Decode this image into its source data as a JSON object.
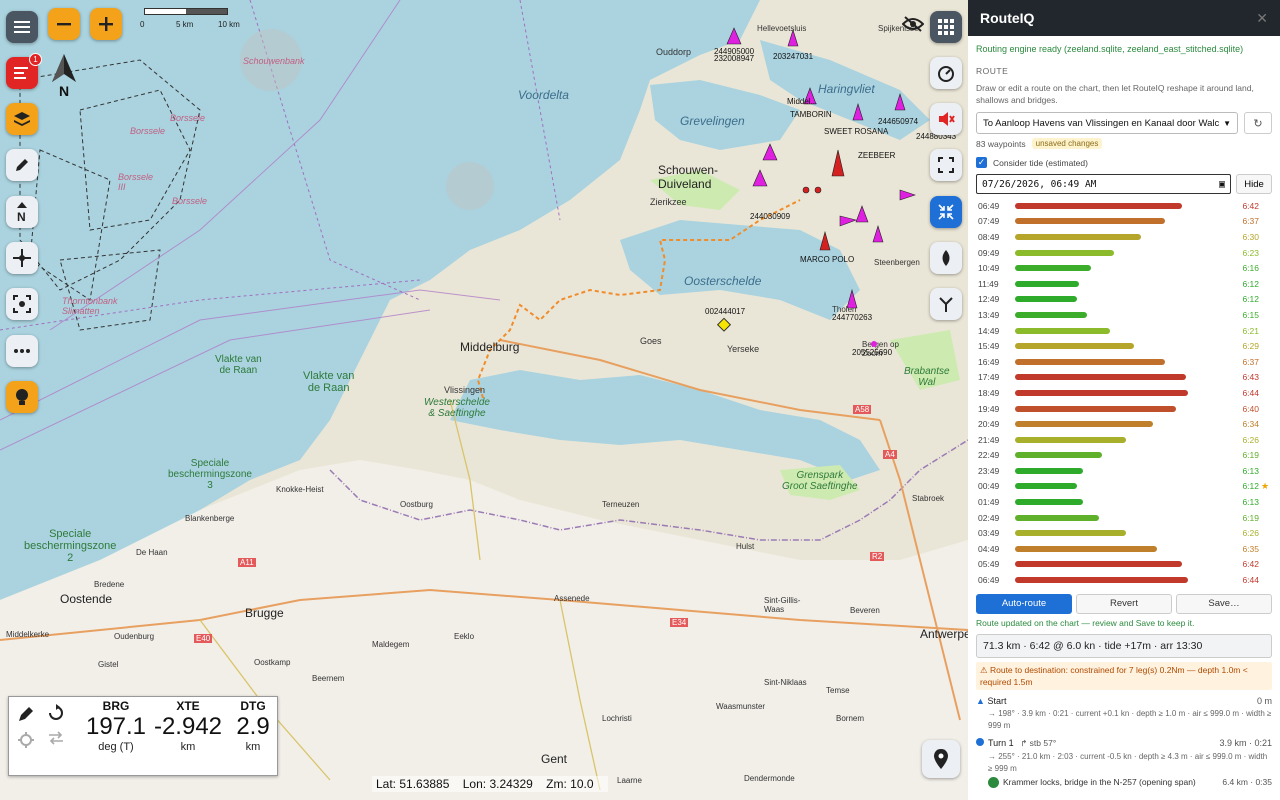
{
  "map": {
    "scale": {
      "t0": "0",
      "t1": "5 km",
      "t2": "10 km"
    },
    "labels": {
      "schouwenbank": "Schouwenbank",
      "voordelta": "Voordelta",
      "grevelingen": "Grevelingen",
      "haringvliet": "Haringvliet",
      "schouwen": "Schouwen-\nDuiveland",
      "oosterschelde": "Oosterschelde",
      "zierikzee": "Zierikzee",
      "middelburg": "Middelburg",
      "vlissingen": "Vlissingen",
      "goes": "Goes",
      "yerseke": "Yerseke",
      "tholen": "Tholen",
      "steenbergen": "Steenbergen",
      "oudorp": "Ouddorp",
      "hellevoetsluis": "Hellevoetsluis",
      "spijkenisse": "Spijkenisse",
      "borssele1": "Borssele",
      "borssele2": "Borssele",
      "borssele3": "Borssele",
      "borssele4": "Borssele\nIII",
      "thornton": "Thorntonbank\nSlimatten",
      "vlakte1": "Vlakte van\nde Raan",
      "vlakte2": "Vlakte van\nde Raan",
      "westerschelde": "Westerschelde\n& Saeftinghe",
      "speciale3": "Speciale\nbeschermingszone\n3",
      "speciale2": "Speciale\nbeschermingszone\n2",
      "knokke": "Knokke-Heist",
      "blankenberge": "Blankenberge",
      "dehaan": "De Haan",
      "bredene": "Bredene",
      "oostende": "Oostende",
      "brugge": "Brugge",
      "middelkerke": "Middelkerke",
      "oudenburg": "Oudenburg",
      "gistel": "Gistel",
      "oostkamp": "Oostkamp",
      "beernem": "Beernem",
      "maldegem": "Maldegem",
      "eeklo": "Eeklo",
      "assenede": "Assenede",
      "terneuzen": "Terneuzen",
      "oostburg": "Oostburg",
      "hulst": "Hulst",
      "sintgillis": "Sint-Gillis-\nWaas",
      "beveren": "Beveren",
      "antwerpen": "Antwerpen",
      "stabroek": "Stabroek",
      "grenspark": "Grenspark\nGroot Saeftinghe",
      "brabantse": "Brabantse\nWal",
      "bergen": "Bergen op\nZoom",
      "stniklaas": "Sint-Niklaas",
      "lochristi": "Lochristi",
      "waasmunster": "Waasmunster",
      "temse": "Temse",
      "bornem": "Bornem",
      "gent": "Gent",
      "laarne": "Laarne",
      "dendermonde": "Dendermonde",
      "a58": "A58",
      "a4": "A4",
      "r2": "R2",
      "e40": "E40",
      "e34": "E34",
      "a11": "A11",
      "v1": "244905000\n232008947",
      "v2": "203247031",
      "v3": "244650974",
      "v4": "244880343",
      "v5": "002444017",
      "v6": "244770263",
      "v7": "205525690",
      "v8": "244030909",
      "v9": "MARCO POLO",
      "v10": "ZEEBEER",
      "v11": "TAMBORIN",
      "v12": "Middel...",
      "v13": "SWEET ROSANA"
    }
  },
  "coords": {
    "lat": "Lat: 51.63885",
    "lon": "Lon: 3.24329",
    "zoom": "Zm: 10.0"
  },
  "nav": {
    "brg": {
      "label": "BRG",
      "value": "197.1",
      "unit": "deg (T)"
    },
    "xte": {
      "label": "XTE",
      "value": "-2.942",
      "unit": "km"
    },
    "dtg": {
      "label": "DTG",
      "value": "2.9",
      "unit": "km"
    }
  },
  "notify_badge": "1",
  "panel": {
    "title": "RouteIQ",
    "close": "✕",
    "status": "Routing engine ready (zeeland.sqlite, zeeland_east_stitched.sqlite)",
    "section": "ROUTE",
    "help": "Draw or edit a route on the chart, then let RouteIQ reshape it around land, shallows and bridges.",
    "route_select": "To Aanloop Havens van Vlissingen en Kanaal door Walcheren",
    "waypoints": "83 waypoints",
    "unsaved": "unsaved changes",
    "consider_tide": "Consider tide (estimated)",
    "datetime": "07/26/2026, 06:49 AM",
    "hide": "Hide",
    "buttons": {
      "auto": "Auto-route",
      "revert": "Revert",
      "save": "Save…"
    },
    "updated": "Route updated on the chart — review and Save to keep it.",
    "summary": "71.3 km · 6:42 @ 6.0 kn · tide +17m · arr 13:30",
    "warning": "⚠ Route to destination: constrained for 7 leg(s) 0.2Nm — depth 1.0m < required 1.5m",
    "legs": [
      {
        "name": "Start",
        "right": "0 m",
        "detail": "→ 198° · 3.9 km · 0:21 · current +0.1 kn · depth ≥ 1.0 m · air ≤ 999.0 m · width ≥ 999 m"
      },
      {
        "name": "Turn 1",
        "turn": "↱ stb 57°",
        "right": "3.9 km · 0:21",
        "detail": "→ 255° · 21.0 km · 2:03 · current -0.5 kn · depth ≥ 4.3 m · air ≤ 999.0 m · width ≥ 999 m",
        "sub": "Krammer locks, bridge in the N-257 (opening span)",
        "sub_right": "6.4 km · 0:35"
      }
    ]
  },
  "tide": [
    {
      "time": "06:49",
      "dur": "6:42",
      "frac": 0.81,
      "color": "#c0392b"
    },
    {
      "time": "07:49",
      "dur": "6:37",
      "frac": 0.73,
      "color": "#c0702b"
    },
    {
      "time": "08:49",
      "dur": "6:30",
      "frac": 0.61,
      "color": "#b6a52b"
    },
    {
      "time": "09:49",
      "dur": "6:23",
      "frac": 0.48,
      "color": "#8bbb2b"
    },
    {
      "time": "10:49",
      "dur": "6:16",
      "frac": 0.37,
      "color": "#3cad2b"
    },
    {
      "time": "11:49",
      "dur": "6:12",
      "frac": 0.31,
      "color": "#2fab2b"
    },
    {
      "time": "12:49",
      "dur": "6:12",
      "frac": 0.3,
      "color": "#2fab2b"
    },
    {
      "time": "13:49",
      "dur": "6:15",
      "frac": 0.35,
      "color": "#3cad2b"
    },
    {
      "time": "14:49",
      "dur": "6:21",
      "frac": 0.46,
      "color": "#8bbb2b"
    },
    {
      "time": "15:49",
      "dur": "6:29",
      "frac": 0.58,
      "color": "#b6a52b"
    },
    {
      "time": "16:49",
      "dur": "6:37",
      "frac": 0.73,
      "color": "#c0702b"
    },
    {
      "time": "17:49",
      "dur": "6:43",
      "frac": 0.83,
      "color": "#c0392b"
    },
    {
      "time": "18:49",
      "dur": "6:44",
      "frac": 0.84,
      "color": "#c0392b"
    },
    {
      "time": "19:49",
      "dur": "6:40",
      "frac": 0.78,
      "color": "#c0502b"
    },
    {
      "time": "20:49",
      "dur": "6:34",
      "frac": 0.67,
      "color": "#c0802b"
    },
    {
      "time": "21:49",
      "dur": "6:26",
      "frac": 0.54,
      "color": "#a8b02b"
    },
    {
      "time": "22:49",
      "dur": "6:19",
      "frac": 0.42,
      "color": "#5fb02b"
    },
    {
      "time": "23:49",
      "dur": "6:13",
      "frac": 0.33,
      "color": "#2fab2b"
    },
    {
      "time": "00:49",
      "dur": "6:12",
      "frac": 0.3,
      "color": "#2fab2b",
      "star": "★"
    },
    {
      "time": "01:49",
      "dur": "6:13",
      "frac": 0.33,
      "color": "#2fab2b"
    },
    {
      "time": "02:49",
      "dur": "6:19",
      "frac": 0.41,
      "color": "#5fb02b"
    },
    {
      "time": "03:49",
      "dur": "6:26",
      "frac": 0.54,
      "color": "#a8b02b"
    },
    {
      "time": "04:49",
      "dur": "6:35",
      "frac": 0.69,
      "color": "#c0802b"
    },
    {
      "time": "05:49",
      "dur": "6:42",
      "frac": 0.81,
      "color": "#c0392b"
    },
    {
      "time": "06:49",
      "dur": "6:44",
      "frac": 0.84,
      "color": "#c0392b"
    }
  ]
}
